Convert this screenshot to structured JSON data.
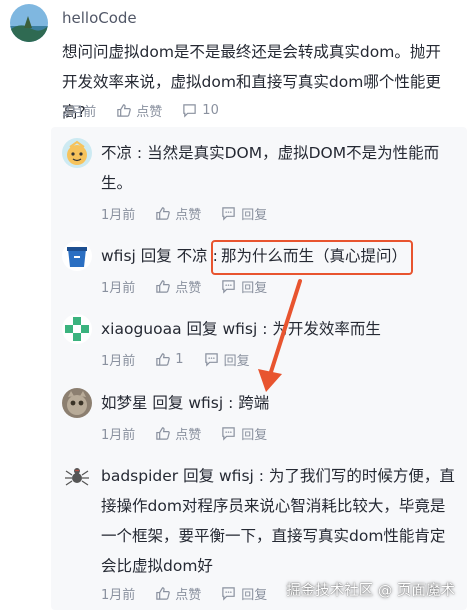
{
  "main_comment": {
    "author": "helloCode",
    "content": "想问问虚拟dom是不是最终还是会转成真实dom。抛开开发效率来说，虚拟dom和直接写真实dom哪个性能更高?",
    "time": "2月前",
    "like_label": "点赞",
    "comment_count": "10"
  },
  "replies": [
    {
      "author": "不凉",
      "content": "不凉 : 当然是真实DOM，虚拟DOM不是为性能而生。",
      "time": "1月前",
      "like_label": "点赞",
      "reply_label": "回复"
    },
    {
      "author_line": "wfisj 回复 不凉 :",
      "content": "那为什么而生（真心提问）",
      "time": "1月前",
      "like_label": "点赞",
      "reply_label": "回复"
    },
    {
      "content": "xiaoguoaa 回复 wfisj : 为开发效率而生",
      "time": "1月前",
      "like_count": "1",
      "reply_label": "回复"
    },
    {
      "content": "如梦星 回复 wfisj : 跨端",
      "time": "1月前",
      "like_label": "点赞",
      "reply_label": "回复"
    },
    {
      "content": "badspider 回复 wfisj : 为了我们写的时候方便，直接操作dom对程序员来说心智消耗比较大，毕竟是一个框架，要平衡一下，直接写真实dom性能肯定会比虚拟dom好",
      "time": "1月前",
      "like_label": "点赞",
      "reply_label": "回复"
    }
  ],
  "watermark": "掘金技术社区 @ 页面魔术",
  "colors": {
    "annotation": "#e8542f",
    "reply_bg": "#f7f8fa",
    "meta_text": "#8a919f"
  }
}
